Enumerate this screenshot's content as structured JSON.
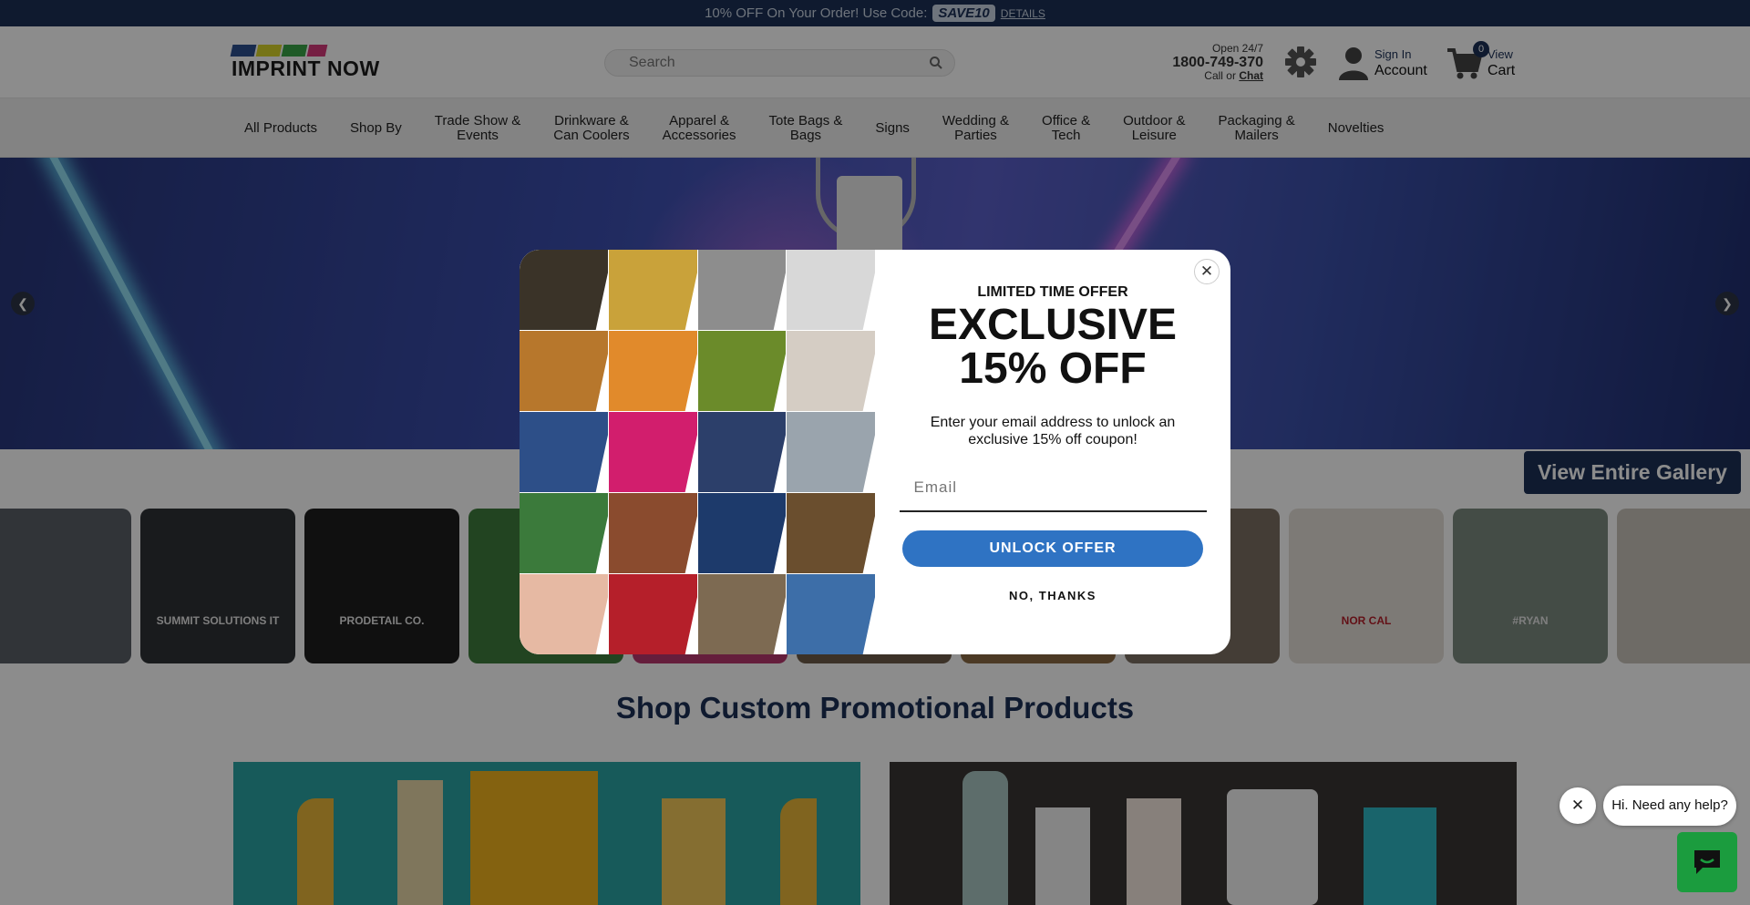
{
  "promo_bar": {
    "text": "10% OFF On Your Order! Use Code:",
    "code": "SAVE10",
    "details": "DETAILS"
  },
  "header": {
    "logo_text": "IMPRINT NOW",
    "search_placeholder": "Search",
    "open_label": "Open 24/7",
    "phone": "1800-749-370",
    "call_or": "Call or",
    "chat_link": "Chat",
    "signin_label": "Sign In",
    "account_label": "Account",
    "cart_count": "0",
    "view_label": "View",
    "cart_label": "Cart"
  },
  "nav": {
    "items": [
      {
        "label": "All Products"
      },
      {
        "label": "Shop By"
      },
      {
        "label": "Trade Show &\nEvents"
      },
      {
        "label": "Drinkware &\nCan Coolers"
      },
      {
        "label": "Apparel &\nAccessories"
      },
      {
        "label": "Tote Bags &\nBags"
      },
      {
        "label": "Signs"
      },
      {
        "label": "Wedding &\nParties"
      },
      {
        "label": "Office &\nTech"
      },
      {
        "label": "Outdoor &\nLeisure"
      },
      {
        "label": "Packaging &\nMailers"
      },
      {
        "label": "Novelties"
      }
    ]
  },
  "hero": {
    "prev_glyph": "❮",
    "next_glyph": "❯"
  },
  "gallery": {
    "button_label": "View Entire Gallery",
    "tiles": [
      {
        "text": "",
        "bg": "#5a5f66"
      },
      {
        "text": "SUMMIT SOLUTIONS IT",
        "bg": "#2f3235"
      },
      {
        "text": "PRODETAIL CO.",
        "bg": "#1e1e1e"
      },
      {
        "text": "",
        "bg": "#3f7d3c"
      },
      {
        "text": "",
        "bg": "#b8386e"
      },
      {
        "text": "",
        "bg": "#6d5b4a"
      },
      {
        "text": "",
        "bg": "#8a6b44"
      },
      {
        "text": "",
        "bg": "#7c6f63"
      },
      {
        "text": "NOR CAL",
        "bg": "#e3dfd8"
      },
      {
        "text": "#RYAN",
        "bg": "#7d8a80"
      },
      {
        "text": "",
        "bg": "#c9c4bb"
      }
    ]
  },
  "shop_section": {
    "title": "Shop Custom Promotional Products"
  },
  "modal": {
    "close_glyph": "✕",
    "kicker": "LIMITED TIME OFFER",
    "headline": "EXCLUSIVE",
    "headline2": "15% OFF",
    "description": "Enter your email address to unlock an exclusive 15% off coupon!",
    "email_placeholder": "Email",
    "unlock_label": "UNLOCK OFFER",
    "decline_label": "NO, THANKS",
    "mosaic_colors": [
      "#3a3328",
      "#c9a23a",
      "#8d8d8d",
      "#d8d8d8",
      "#b7772c",
      "#e18a2b",
      "#6b8b2a",
      "#d5cdc4",
      "#2d4f88",
      "#d21e6d",
      "#2c3f6a",
      "#9aa4ad",
      "#3b7a3b",
      "#8a4b2e",
      "#1d3a6b",
      "#6a4e2e",
      "#e6b9a3",
      "#b51f2a",
      "#7d6a52",
      "#3d6ea8"
    ]
  },
  "chat": {
    "close_glyph": "✕",
    "bubble_text": "Hi. Need any help?"
  },
  "colors": {
    "navy": "#1c3157",
    "unlock_blue": "#2f73c3",
    "chat_green": "#1b9c3e"
  }
}
